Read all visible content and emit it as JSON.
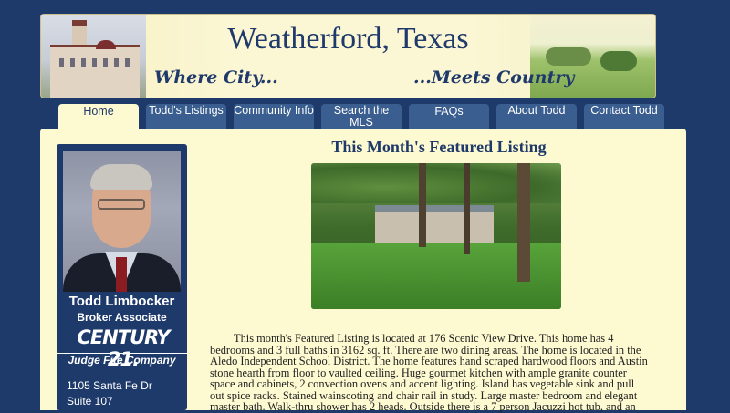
{
  "header": {
    "title": "Weatherford, Texas",
    "tagline_left": "Where City...",
    "tagline_right": "...Meets Country"
  },
  "nav": {
    "tabs": [
      {
        "label": "Home",
        "active": true
      },
      {
        "label": "Todd's Listings",
        "active": false
      },
      {
        "label": "Community Info",
        "active": false
      },
      {
        "label": "Search the MLS",
        "active": false
      },
      {
        "label": "FAQs",
        "active": false
      },
      {
        "label": "About Todd",
        "active": false
      },
      {
        "label": "Contact Todd",
        "active": false
      }
    ]
  },
  "sidebar": {
    "agent_name": "Todd Limbocker",
    "agent_title": "Broker Associate",
    "logo_brand": "CENTURY 21.",
    "logo_company": "Judge Fite Company",
    "address_line1": "1105 Santa Fe Dr",
    "address_line2": "Suite 107"
  },
  "main": {
    "title": "This Month's Featured Listing",
    "description": "This month's Featured Listing is located at 176 Scenic View Drive.  This home has 4 bedrooms and 3 full baths in 3162 sq. ft.  There are two dining areas.  The home is located in the Aledo Independent School District.  The home features hand scraped hardwood floors and Austin stone hearth from floor to vaulted ceiling.  Huge gourmet kitchen with ample granite counter space and cabinets, 2 convection ovens and accent lighting.  Island has vegetable sink and pull out spice racks.  Stained wainscoting and chair rail in study.  Large master bedroom and elegant master bath.  Walk-thru shower has 2 heads.  Outside there is a 7 person Jacuzzi hot tub, and an"
  },
  "colors": {
    "background": "#1e3a6b",
    "panel": "#fdf9d0",
    "tab": "#3a5e8f",
    "title": "#1f3a6a"
  }
}
